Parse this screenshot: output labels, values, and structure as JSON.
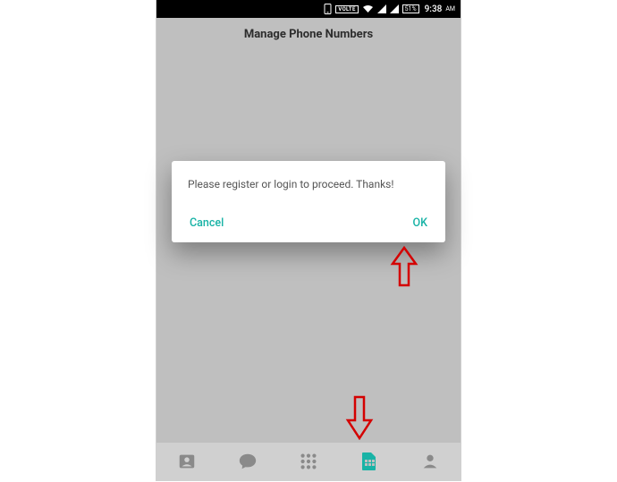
{
  "status_bar": {
    "volte_label": "VOLTE",
    "battery_text": "51%",
    "time": "9:38",
    "ampm": "AM"
  },
  "header": {
    "title": "Manage Phone Numbers"
  },
  "dialog": {
    "message": "Please register or login to proceed. Thanks!",
    "cancel_label": "Cancel",
    "ok_label": "OK"
  },
  "nav": {
    "items": [
      {
        "name": "contacts"
      },
      {
        "name": "chat"
      },
      {
        "name": "dialpad"
      },
      {
        "name": "sim"
      },
      {
        "name": "profile"
      }
    ],
    "active_index": 3
  }
}
